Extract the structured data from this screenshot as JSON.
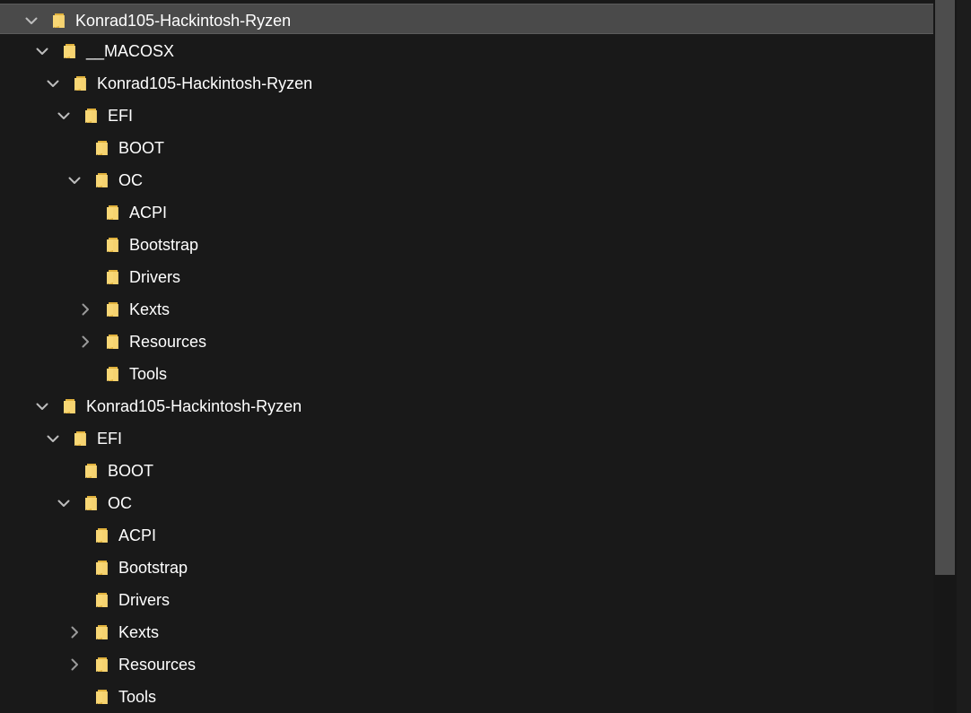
{
  "tree": {
    "rows": [
      {
        "label": "Konrad105-Hackintosh-Ryzen",
        "depth": 0,
        "expander": "expanded",
        "selected": true
      },
      {
        "label": "__MACOSX",
        "depth": 1,
        "expander": "expanded",
        "selected": false
      },
      {
        "label": "Konrad105-Hackintosh-Ryzen",
        "depth": 2,
        "expander": "expanded",
        "selected": false
      },
      {
        "label": "EFI",
        "depth": 3,
        "expander": "expanded",
        "selected": false
      },
      {
        "label": "BOOT",
        "depth": 4,
        "expander": "none",
        "selected": false
      },
      {
        "label": "OC",
        "depth": 4,
        "expander": "expanded",
        "selected": false
      },
      {
        "label": "ACPI",
        "depth": 5,
        "expander": "none",
        "selected": false
      },
      {
        "label": "Bootstrap",
        "depth": 5,
        "expander": "none",
        "selected": false
      },
      {
        "label": "Drivers",
        "depth": 5,
        "expander": "none",
        "selected": false
      },
      {
        "label": "Kexts",
        "depth": 5,
        "expander": "collapsed",
        "selected": false
      },
      {
        "label": "Resources",
        "depth": 5,
        "expander": "collapsed",
        "selected": false
      },
      {
        "label": "Tools",
        "depth": 5,
        "expander": "none",
        "selected": false
      },
      {
        "label": "Konrad105-Hackintosh-Ryzen",
        "depth": 1,
        "expander": "expanded",
        "selected": false
      },
      {
        "label": "EFI",
        "depth": 2,
        "expander": "expanded",
        "selected": false
      },
      {
        "label": "BOOT",
        "depth": 3,
        "expander": "none",
        "selected": false
      },
      {
        "label": "OC",
        "depth": 3,
        "expander": "expanded",
        "selected": false
      },
      {
        "label": "ACPI",
        "depth": 4,
        "expander": "none",
        "selected": false
      },
      {
        "label": "Bootstrap",
        "depth": 4,
        "expander": "none",
        "selected": false
      },
      {
        "label": "Drivers",
        "depth": 4,
        "expander": "none",
        "selected": false
      },
      {
        "label": "Kexts",
        "depth": 4,
        "expander": "collapsed",
        "selected": false
      },
      {
        "label": "Resources",
        "depth": 4,
        "expander": "collapsed",
        "selected": false
      },
      {
        "label": "Tools",
        "depth": 4,
        "expander": "none",
        "selected": false
      }
    ],
    "icons": {
      "expanded": "chevron-down-icon",
      "collapsed": "chevron-right-icon",
      "folder": "folder-icon"
    },
    "colors": {
      "background": "#191919",
      "selected_row": "#4a4a4a",
      "text": "#ffffff",
      "chevron": "#bdbdbd",
      "folder_front": "#f8d775",
      "folder_back": "#e0b13c",
      "scrollbar_thumb": "#4d4d4d"
    }
  }
}
